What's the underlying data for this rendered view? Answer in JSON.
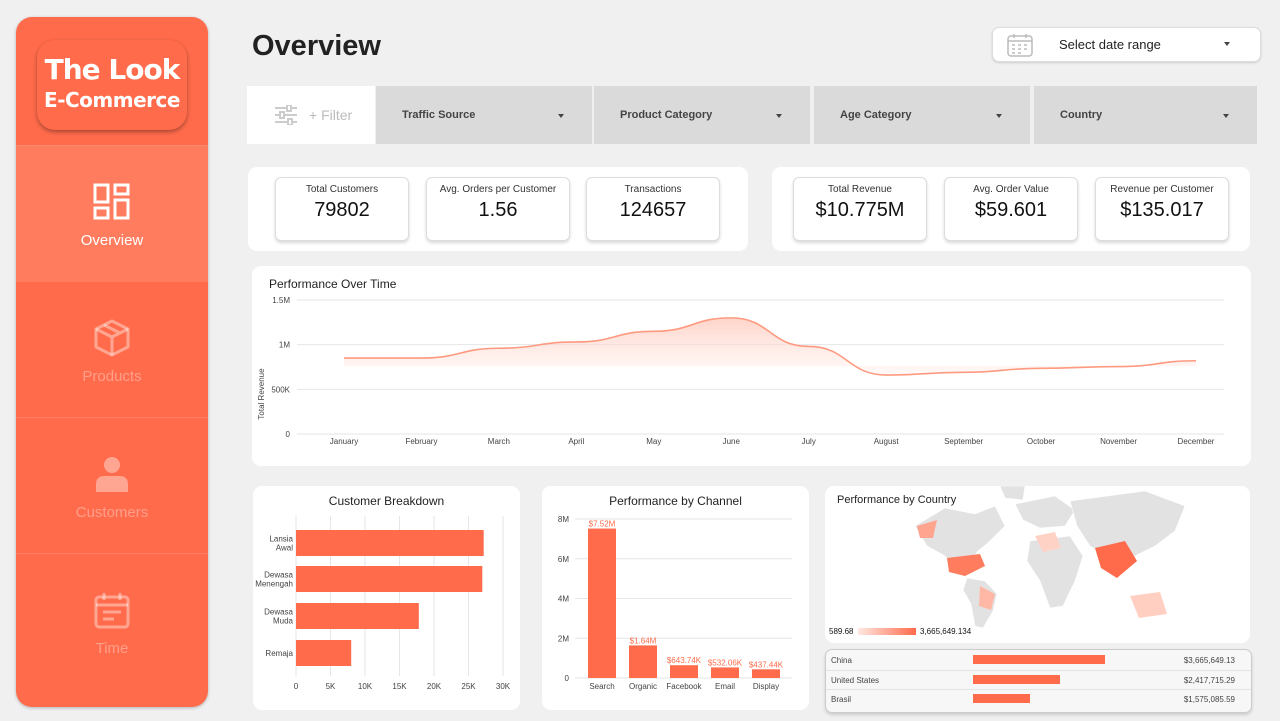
{
  "brand": {
    "line1": "The Look",
    "line2": "E-Commerce",
    "accent": "#ff6b4b"
  },
  "nav": [
    {
      "label": "Overview",
      "icon": "dashboard-icon",
      "active": true
    },
    {
      "label": "Products",
      "icon": "box-icon",
      "active": false
    },
    {
      "label": "Customers",
      "icon": "user-icon",
      "active": false
    },
    {
      "label": "Time",
      "icon": "calendar-icon",
      "active": false
    }
  ],
  "header": {
    "title": "Overview",
    "date_range_label": "Select date range"
  },
  "filters": {
    "button": "+ Filter",
    "dropdowns": [
      "Traffic Source",
      "Product Category",
      "Age Category",
      "Country"
    ]
  },
  "kpis_left": [
    {
      "label": "Total Customers",
      "value": "79802"
    },
    {
      "label": "Avg. Orders per Customer",
      "value": "1.56"
    },
    {
      "label": "Transactions",
      "value": "124657"
    }
  ],
  "kpis_right": [
    {
      "label": "Total Revenue",
      "value": "$10.775M"
    },
    {
      "label": "Avg. Order Value",
      "value": "$59.601"
    },
    {
      "label": "Revenue per Customer",
      "value": "$135.017"
    }
  ],
  "chart_data": [
    {
      "type": "area",
      "title": "Performance Over Time",
      "ylabel": "Total Revenue",
      "x": [
        "January",
        "February",
        "March",
        "April",
        "May",
        "June",
        "July",
        "August",
        "September",
        "October",
        "November",
        "December"
      ],
      "values": [
        850000,
        850000,
        960000,
        1030000,
        1150000,
        1300000,
        980000,
        660000,
        690000,
        735000,
        755000,
        820000
      ],
      "ylim": [
        0,
        1500000
      ],
      "yticks": [
        0,
        500000,
        1000000,
        1500000
      ],
      "ytick_labels": [
        "0",
        "500K",
        "1M",
        "1.5M"
      ],
      "grid": true
    },
    {
      "type": "bar",
      "orientation": "horizontal",
      "title": "Customer Breakdown",
      "categories": [
        "Lansia Awal",
        "Dewasa Menengah",
        "Dewasa Muda",
        "Remaja"
      ],
      "category_lines": [
        [
          "Lansia",
          "Awal"
        ],
        [
          "Dewasa",
          "Menengah"
        ],
        [
          "Dewasa",
          "Muda"
        ],
        [
          "Remaja"
        ]
      ],
      "values": [
        27200,
        27000,
        17800,
        8000
      ],
      "xlim": [
        0,
        30000
      ],
      "xticks": [
        0,
        5000,
        10000,
        15000,
        20000,
        25000,
        30000
      ],
      "xtick_labels": [
        "0",
        "5K",
        "10K",
        "15K",
        "20K",
        "25K",
        "30K"
      ]
    },
    {
      "type": "bar",
      "title": "Performance by Channel",
      "categories": [
        "Search",
        "Organic",
        "Facebook",
        "Email",
        "Display"
      ],
      "values": [
        7520000,
        1640000,
        643740,
        532060,
        437440
      ],
      "data_labels": [
        "$7.52M",
        "$1.64M",
        "$643.74K",
        "$532.06K",
        "$437.44K"
      ],
      "ylim": [
        0,
        8000000
      ],
      "yticks": [
        0,
        2000000,
        4000000,
        6000000,
        8000000
      ],
      "ytick_labels": [
        "0",
        "2M",
        "4M",
        "6M",
        "8M"
      ]
    },
    {
      "type": "table",
      "title": "Performance by Country",
      "legend_min": "589.68",
      "legend_max": "3,665,649.134",
      "rows": [
        {
          "country": "China",
          "value": 3665649.13,
          "label": "$3,665,649.13"
        },
        {
          "country": "United States",
          "value": 2417715.29,
          "label": "$2,417,715.29"
        },
        {
          "country": "Brasil",
          "value": 1575085.59,
          "label": "$1,575,085.59"
        }
      ]
    }
  ]
}
